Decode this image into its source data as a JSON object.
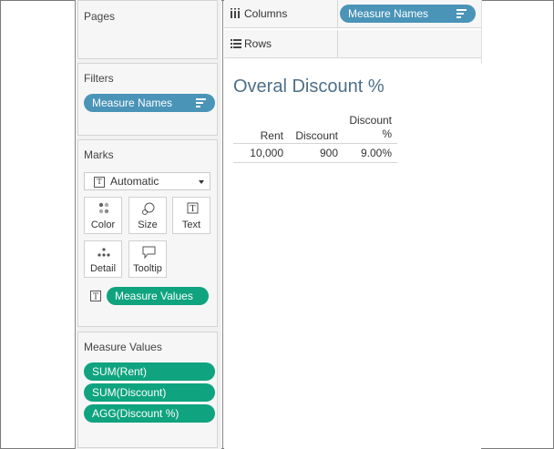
{
  "pages": {
    "title": "Pages"
  },
  "filters": {
    "title": "Filters",
    "pills": [
      {
        "label": "Measure Names"
      }
    ]
  },
  "marks": {
    "title": "Marks",
    "mark_type": "Automatic",
    "buttons": {
      "color": "Color",
      "size": "Size",
      "text": "Text",
      "detail": "Detail",
      "tooltip": "Tooltip"
    },
    "text_pill": "Measure Values"
  },
  "measure_values": {
    "title": "Measure Values",
    "pills": [
      "SUM(Rent)",
      "SUM(Discount)",
      "AGG(Discount %)"
    ]
  },
  "shelves": {
    "columns": {
      "label": "Columns",
      "pill": "Measure Names"
    },
    "rows": {
      "label": "Rows"
    }
  },
  "view": {
    "title": "Overal Discount %",
    "table": {
      "headers": [
        "Rent",
        "Discount",
        "Discount",
        "%"
      ],
      "row": [
        "10,000",
        "900",
        "9.00%"
      ]
    }
  },
  "colors": {
    "blue_pill": "#4a94b8",
    "green_pill": "#0fa37f",
    "title": "#4e6f88"
  }
}
